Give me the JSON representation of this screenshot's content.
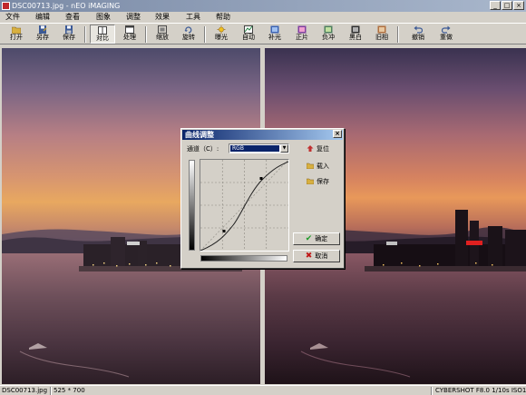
{
  "window": {
    "title": "DSC00713.jpg - nEO iMAGING",
    "controls": [
      "_",
      "□",
      "×"
    ]
  },
  "menu": [
    {
      "label": "文件"
    },
    {
      "label": "编辑"
    },
    {
      "label": "查看"
    },
    {
      "label": "图象"
    },
    {
      "label": "调整"
    },
    {
      "label": "效果"
    },
    {
      "label": "工具"
    },
    {
      "label": "帮助"
    }
  ],
  "toolbar": [
    {
      "label": "打开",
      "icon": "open-folder-icon",
      "color": "#d8b040"
    },
    {
      "label": "另存",
      "icon": "save-as-icon",
      "color": "#3c5a96"
    },
    {
      "label": "保存",
      "icon": "save-disk-icon",
      "color": "#3c5a96"
    },
    {
      "label": "对比",
      "icon": "compare-icon",
      "color": "#606060",
      "pressed": true
    },
    {
      "label": "处理",
      "icon": "process-icon",
      "color": "#606060"
    },
    {
      "label": "缩放",
      "icon": "resize-icon",
      "color": "#4a4a4a"
    },
    {
      "label": "旋转",
      "icon": "rotate-icon",
      "color": "#3c5a96"
    },
    {
      "label": "曝光",
      "icon": "exposure-icon",
      "color": "#d0a020"
    },
    {
      "label": "自动",
      "icon": "auto-icon",
      "color": "#208040"
    },
    {
      "label": "补光",
      "icon": "fill-light-icon",
      "color": "#3c64b4"
    },
    {
      "label": "正片",
      "icon": "positive-icon",
      "color": "#8040a0"
    },
    {
      "label": "负冲",
      "icon": "cross-process-icon",
      "color": "#508060"
    },
    {
      "label": "黑白",
      "icon": "black-white-icon",
      "color": "#303030"
    },
    {
      "label": "旧相",
      "icon": "old-photo-icon",
      "color": "#b07040"
    },
    {
      "label": "撤销",
      "icon": "undo-icon",
      "color": "#3c5a96"
    },
    {
      "label": "重做",
      "icon": "redo-icon",
      "color": "#3c5a96"
    }
  ],
  "status": {
    "filename": "DSC00713.jpg",
    "dimensions": "525 * 700",
    "exif": "CYBERSHOT F8.0 1/10s ISO100"
  },
  "dialog": {
    "title": "曲线调整",
    "channel_label": "通道（C）:",
    "channel_value": "RGB",
    "reset_label": "复位",
    "load_label": "载入",
    "save_label": "保存",
    "ok_label": "确定",
    "cancel_label": "取消"
  },
  "colors": {
    "window_face": "#d4d0c8",
    "title_gradient_start": "#0a246a",
    "ok_check": "#1f9a2a",
    "cancel_x": "#c01818"
  }
}
